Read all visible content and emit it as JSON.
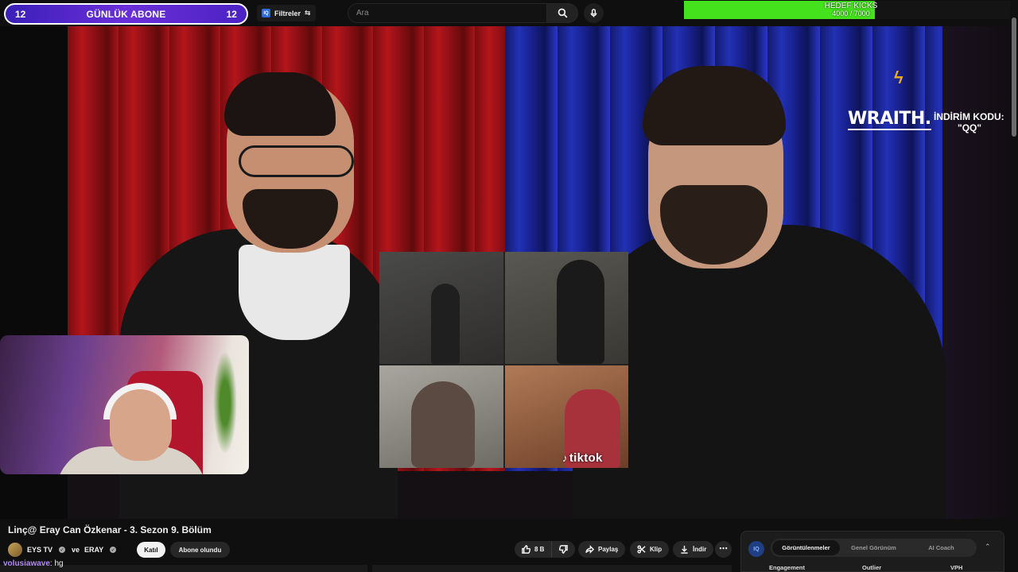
{
  "overlay": {
    "sub_goal": {
      "left_count": "12",
      "title": "GÜNLÜK ABONE",
      "right_count": "12"
    },
    "kick_goal": {
      "title": "HEDEF KICKS",
      "progress_text": "4000 / 7000",
      "current": 4000,
      "target": 7000,
      "color": "#44e21c"
    },
    "sponsor": {
      "brand": "WRAITH.",
      "promo_label": "İNDİRİM KODU:",
      "promo_code": "\"QQ\""
    },
    "tiktok_watermark": "tiktok"
  },
  "header": {
    "filter_label": "Filtreler",
    "filter_icon": "sliders-icon",
    "search_placeholder": "Ara",
    "search_icon": "search-icon",
    "mic_icon": "mic-icon"
  },
  "video": {
    "title": "Linç@ Eray Can Özkenar - 3. Sezon 9. Bölüm",
    "channel": {
      "name": "EYS TV",
      "joiner": "ve",
      "collab": "ERAY"
    },
    "join_label": "Katıl",
    "subscribed_label": "Abone olundu",
    "actions": {
      "likes": "8 B",
      "share": "Paylaş",
      "clip": "Klip",
      "download": "İndir"
    }
  },
  "chat": {
    "user": "volusiawave",
    "message": ": hg"
  },
  "iq_panel": {
    "logo": "IQ",
    "tabs": [
      "Görüntülenmeler",
      "Genel Görünüm",
      "AI Coach"
    ],
    "active_tab": 0,
    "metrics": [
      "Engagement",
      "Outlier",
      "VPH"
    ]
  },
  "colors": {
    "accent": "#3ea6ff",
    "sub_goal_bg": "#4b22c4",
    "brand_red": "#b3161c",
    "brand_blue": "#2231b4"
  }
}
